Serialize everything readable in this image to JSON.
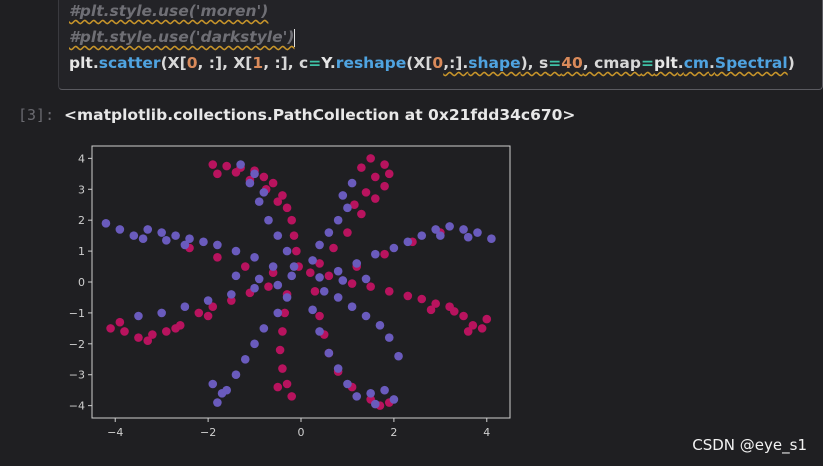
{
  "code_cell": {
    "line1": "#plt.style.use('moren')",
    "line2": "#plt.style.use('darkstyle')",
    "line3": {
      "p1": "plt",
      "p2": ".",
      "p3": "scatter",
      "p4": "(X[",
      "p5": "0",
      "p6": ", :], X[",
      "p7": "1",
      "p8": ", :], c",
      "p9": "=",
      "p10": "Y",
      "p11": ".",
      "p12": "reshape",
      "p13": "(X[",
      "p14": "0",
      "p15": ",:].",
      "p16": "shape",
      "p17": "), s",
      "p18": "=",
      "p19": "40",
      "p20": ", cmap",
      "p21": "=",
      "p22": "plt",
      "p23": ".",
      "p24": "cm",
      "p25": ".",
      "p26": "Spectral",
      "p27": ")"
    }
  },
  "output": {
    "prompt": "[3]:",
    "text": "<matplotlib.collections.PathCollection at 0x21fdd34c670>"
  },
  "watermark": "CSDN @eye_s1",
  "chart_data": {
    "type": "scatter",
    "xlim": [
      -4.5,
      4.5
    ],
    "ylim": [
      -4.4,
      4.4
    ],
    "xticks": [
      -4,
      -2,
      0,
      2,
      4
    ],
    "yticks": [
      -4,
      -3,
      -2,
      -1,
      0,
      1,
      2,
      3,
      4
    ],
    "xtick_labels": [
      "−4",
      "−2",
      "0",
      "2",
      "4"
    ],
    "ytick_labels": [
      "−4",
      "−3",
      "−2",
      "−1",
      "0",
      "1",
      "2",
      "3",
      "4"
    ],
    "grid": false,
    "colors": {
      "red_class": "#b8135e",
      "blue_class": "#6a5bbd",
      "background": "#1f1f22",
      "axes": "#cfcfcf"
    },
    "series": [
      {
        "color_key": "red_class",
        "points": [
          [
            -1.9,
            3.8
          ],
          [
            -1.6,
            3.75
          ],
          [
            -1.3,
            3.7
          ],
          [
            -1.0,
            3.6
          ],
          [
            -0.8,
            3.4
          ],
          [
            -0.6,
            3.2
          ],
          [
            -0.4,
            2.8
          ],
          [
            -0.3,
            2.4
          ],
          [
            -0.2,
            2.0
          ],
          [
            -0.15,
            1.5
          ],
          [
            -0.1,
            1.0
          ],
          [
            -0.05,
            0.5
          ],
          [
            -1.8,
            3.5
          ],
          [
            -1.4,
            3.55
          ],
          [
            -1.1,
            3.3
          ],
          [
            -0.75,
            3.0
          ],
          [
            -0.5,
            2.6
          ],
          [
            1.5,
            4.0
          ],
          [
            1.8,
            3.8
          ],
          [
            1.9,
            3.5
          ],
          [
            1.8,
            3.1
          ],
          [
            1.6,
            2.7
          ],
          [
            1.3,
            2.2
          ],
          [
            1.0,
            1.6
          ],
          [
            0.7,
            1.1
          ],
          [
            0.4,
            0.6
          ],
          [
            0.2,
            0.3
          ],
          [
            1.3,
            3.7
          ],
          [
            1.6,
            3.4
          ],
          [
            1.4,
            2.9
          ],
          [
            1.15,
            2.5
          ],
          [
            4.0,
            -1.2
          ],
          [
            3.7,
            -1.4
          ],
          [
            3.5,
            -1.1
          ],
          [
            3.2,
            -0.8
          ],
          [
            2.9,
            -0.7
          ],
          [
            2.6,
            -0.55
          ],
          [
            2.3,
            -0.45
          ],
          [
            1.9,
            -0.3
          ],
          [
            1.5,
            -0.15
          ],
          [
            1.1,
            -0.05
          ],
          [
            3.9,
            -1.5
          ],
          [
            3.6,
            -1.6
          ],
          [
            3.3,
            -0.95
          ],
          [
            2.8,
            -0.9
          ],
          [
            -4.1,
            -1.5
          ],
          [
            -3.8,
            -1.6
          ],
          [
            -3.5,
            -1.8
          ],
          [
            -3.2,
            -1.7
          ],
          [
            -2.9,
            -1.6
          ],
          [
            -2.6,
            -1.4
          ],
          [
            -2.2,
            -1.0
          ],
          [
            -1.9,
            -0.8
          ],
          [
            -1.5,
            -0.6
          ],
          [
            -1.1,
            -0.35
          ],
          [
            -0.7,
            -0.15
          ],
          [
            -3.9,
            -1.3
          ],
          [
            -3.3,
            -1.9
          ],
          [
            -2.7,
            -1.5
          ],
          [
            -2.0,
            -1.1
          ],
          [
            -0.3,
            -0.4
          ],
          [
            -0.35,
            -1.0
          ],
          [
            -0.4,
            -1.6
          ],
          [
            -0.45,
            -2.2
          ],
          [
            -0.4,
            -2.8
          ],
          [
            -0.3,
            -3.3
          ],
          [
            -0.2,
            -3.7
          ],
          [
            -0.5,
            -3.4
          ],
          [
            0.3,
            -0.3
          ],
          [
            0.4,
            -1.1
          ],
          [
            0.5,
            -1.7
          ],
          [
            0.6,
            -2.3
          ],
          [
            0.8,
            -2.9
          ],
          [
            1.1,
            -3.4
          ],
          [
            1.5,
            -3.8
          ],
          [
            1.9,
            -3.9
          ],
          [
            1.7,
            -4.0
          ],
          [
            -0.6,
            0.3
          ],
          [
            -1.2,
            0.5
          ],
          [
            -1.8,
            0.8
          ],
          [
            -2.4,
            1.1
          ],
          [
            0.6,
            0.2
          ],
          [
            1.2,
            0.5
          ],
          [
            1.8,
            0.9
          ],
          [
            2.4,
            1.3
          ],
          [
            3.0,
            1.6
          ]
        ]
      },
      {
        "color_key": "blue_class",
        "points": [
          [
            -4.2,
            1.9
          ],
          [
            -3.9,
            1.7
          ],
          [
            -3.6,
            1.5
          ],
          [
            -3.3,
            1.7
          ],
          [
            -3.0,
            1.6
          ],
          [
            -2.7,
            1.5
          ],
          [
            -2.4,
            1.4
          ],
          [
            -2.1,
            1.3
          ],
          [
            -1.8,
            1.2
          ],
          [
            -1.4,
            1.0
          ],
          [
            -1.0,
            0.8
          ],
          [
            -0.6,
            0.5
          ],
          [
            -0.2,
            0.2
          ],
          [
            -3.4,
            1.4
          ],
          [
            -2.9,
            1.35
          ],
          [
            -2.5,
            1.2
          ],
          [
            -1.3,
            3.8
          ],
          [
            -1.1,
            3.2
          ],
          [
            -0.9,
            2.6
          ],
          [
            -0.7,
            2.0
          ],
          [
            -0.5,
            1.5
          ],
          [
            -0.3,
            1.0
          ],
          [
            -0.15,
            0.5
          ],
          [
            -1.0,
            3.5
          ],
          [
            -0.8,
            2.9
          ],
          [
            1.0,
            2.4
          ],
          [
            0.8,
            2.0
          ],
          [
            0.6,
            1.6
          ],
          [
            0.4,
            1.2
          ],
          [
            0.25,
            0.7
          ],
          [
            0.9,
            2.8
          ],
          [
            1.1,
            3.2
          ],
          [
            4.1,
            1.4
          ],
          [
            3.8,
            1.6
          ],
          [
            3.5,
            1.7
          ],
          [
            3.2,
            1.8
          ],
          [
            2.9,
            1.7
          ],
          [
            2.6,
            1.5
          ],
          [
            2.3,
            1.3
          ],
          [
            2.0,
            1.1
          ],
          [
            1.6,
            0.9
          ],
          [
            1.2,
            0.6
          ],
          [
            0.8,
            0.35
          ],
          [
            0.4,
            0.15
          ],
          [
            3.6,
            1.45
          ],
          [
            3.0,
            1.5
          ],
          [
            1.9,
            -1.8
          ],
          [
            1.7,
            -1.4
          ],
          [
            1.4,
            -1.1
          ],
          [
            1.1,
            -0.8
          ],
          [
            0.8,
            -0.5
          ],
          [
            0.5,
            -0.3
          ],
          [
            2.1,
            -2.4
          ],
          [
            1.5,
            -3.6
          ],
          [
            1.8,
            -3.5
          ],
          [
            1.2,
            -3.7
          ],
          [
            1.0,
            -3.3
          ],
          [
            0.8,
            -2.8
          ],
          [
            0.6,
            -2.3
          ],
          [
            0.4,
            -1.6
          ],
          [
            0.25,
            -0.9
          ],
          [
            2.0,
            -3.8
          ],
          [
            1.6,
            -3.95
          ],
          [
            -1.8,
            -3.9
          ],
          [
            -1.6,
            -3.5
          ],
          [
            -1.4,
            -3.0
          ],
          [
            -1.2,
            -2.5
          ],
          [
            -1.0,
            -2.0
          ],
          [
            -0.8,
            -1.5
          ],
          [
            -0.5,
            -1.0
          ],
          [
            -0.3,
            -0.5
          ],
          [
            -1.9,
            -3.3
          ],
          [
            -1.7,
            -3.6
          ],
          [
            -3.5,
            -1.1
          ],
          [
            -3.0,
            -1.0
          ],
          [
            -2.5,
            -0.8
          ],
          [
            -2.0,
            -0.6
          ],
          [
            -1.5,
            -0.4
          ],
          [
            -1.0,
            -0.2
          ],
          [
            -0.5,
            -0.1
          ],
          [
            -1.4,
            0.2
          ],
          [
            -0.9,
            0.1
          ],
          [
            0.9,
            0.05
          ],
          [
            1.4,
            0.1
          ]
        ]
      }
    ]
  }
}
